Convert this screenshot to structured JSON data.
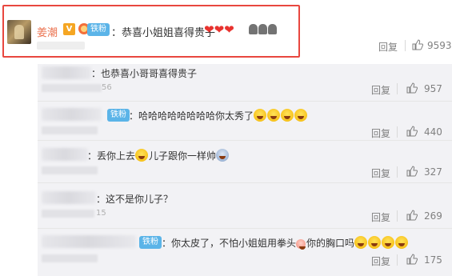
{
  "main_comment": {
    "author": "姜潮",
    "badge_v": "V",
    "fan_badge": "铁粉",
    "text": "：恭喜小姐姐喜得贵子",
    "heart_emojis": [
      "❤",
      "❤",
      "❤"
    ],
    "extra_icons": [
      "clap-hands-icon",
      "clap-hands-icon",
      "clap-hands-icon"
    ],
    "reply_label": "回复",
    "like_count": "9593"
  },
  "replies": [
    {
      "text": "：也恭喜小哥哥喜得贵子",
      "time_suffix": "56",
      "reply_label": "回复",
      "like_count": "957",
      "fan_badge": ""
    },
    {
      "text": "：哈哈哈哈哈哈哈哈你太秀了",
      "time_suffix": "",
      "reply_label": "回复",
      "like_count": "440",
      "fan_badge": "铁粉"
    },
    {
      "text": "：丢你上去",
      "text2": "儿子跟你一样帅",
      "time_suffix": "",
      "reply_label": "回复",
      "like_count": "327",
      "fan_badge": ""
    },
    {
      "text": "：这不是你儿子？",
      "time_suffix": "15",
      "reply_label": "回复",
      "like_count": "269",
      "fan_badge": ""
    },
    {
      "text": "：你太皮了，不怕小姐姐用拳头",
      "text2": "你的胸口吗",
      "time_suffix": "",
      "reply_label": "回复",
      "like_count": "175",
      "fan_badge": "铁粉"
    }
  ],
  "colors": {
    "highlight": "#e8473f",
    "name": "#eb7350",
    "tiefen": "#5bb4e8"
  }
}
